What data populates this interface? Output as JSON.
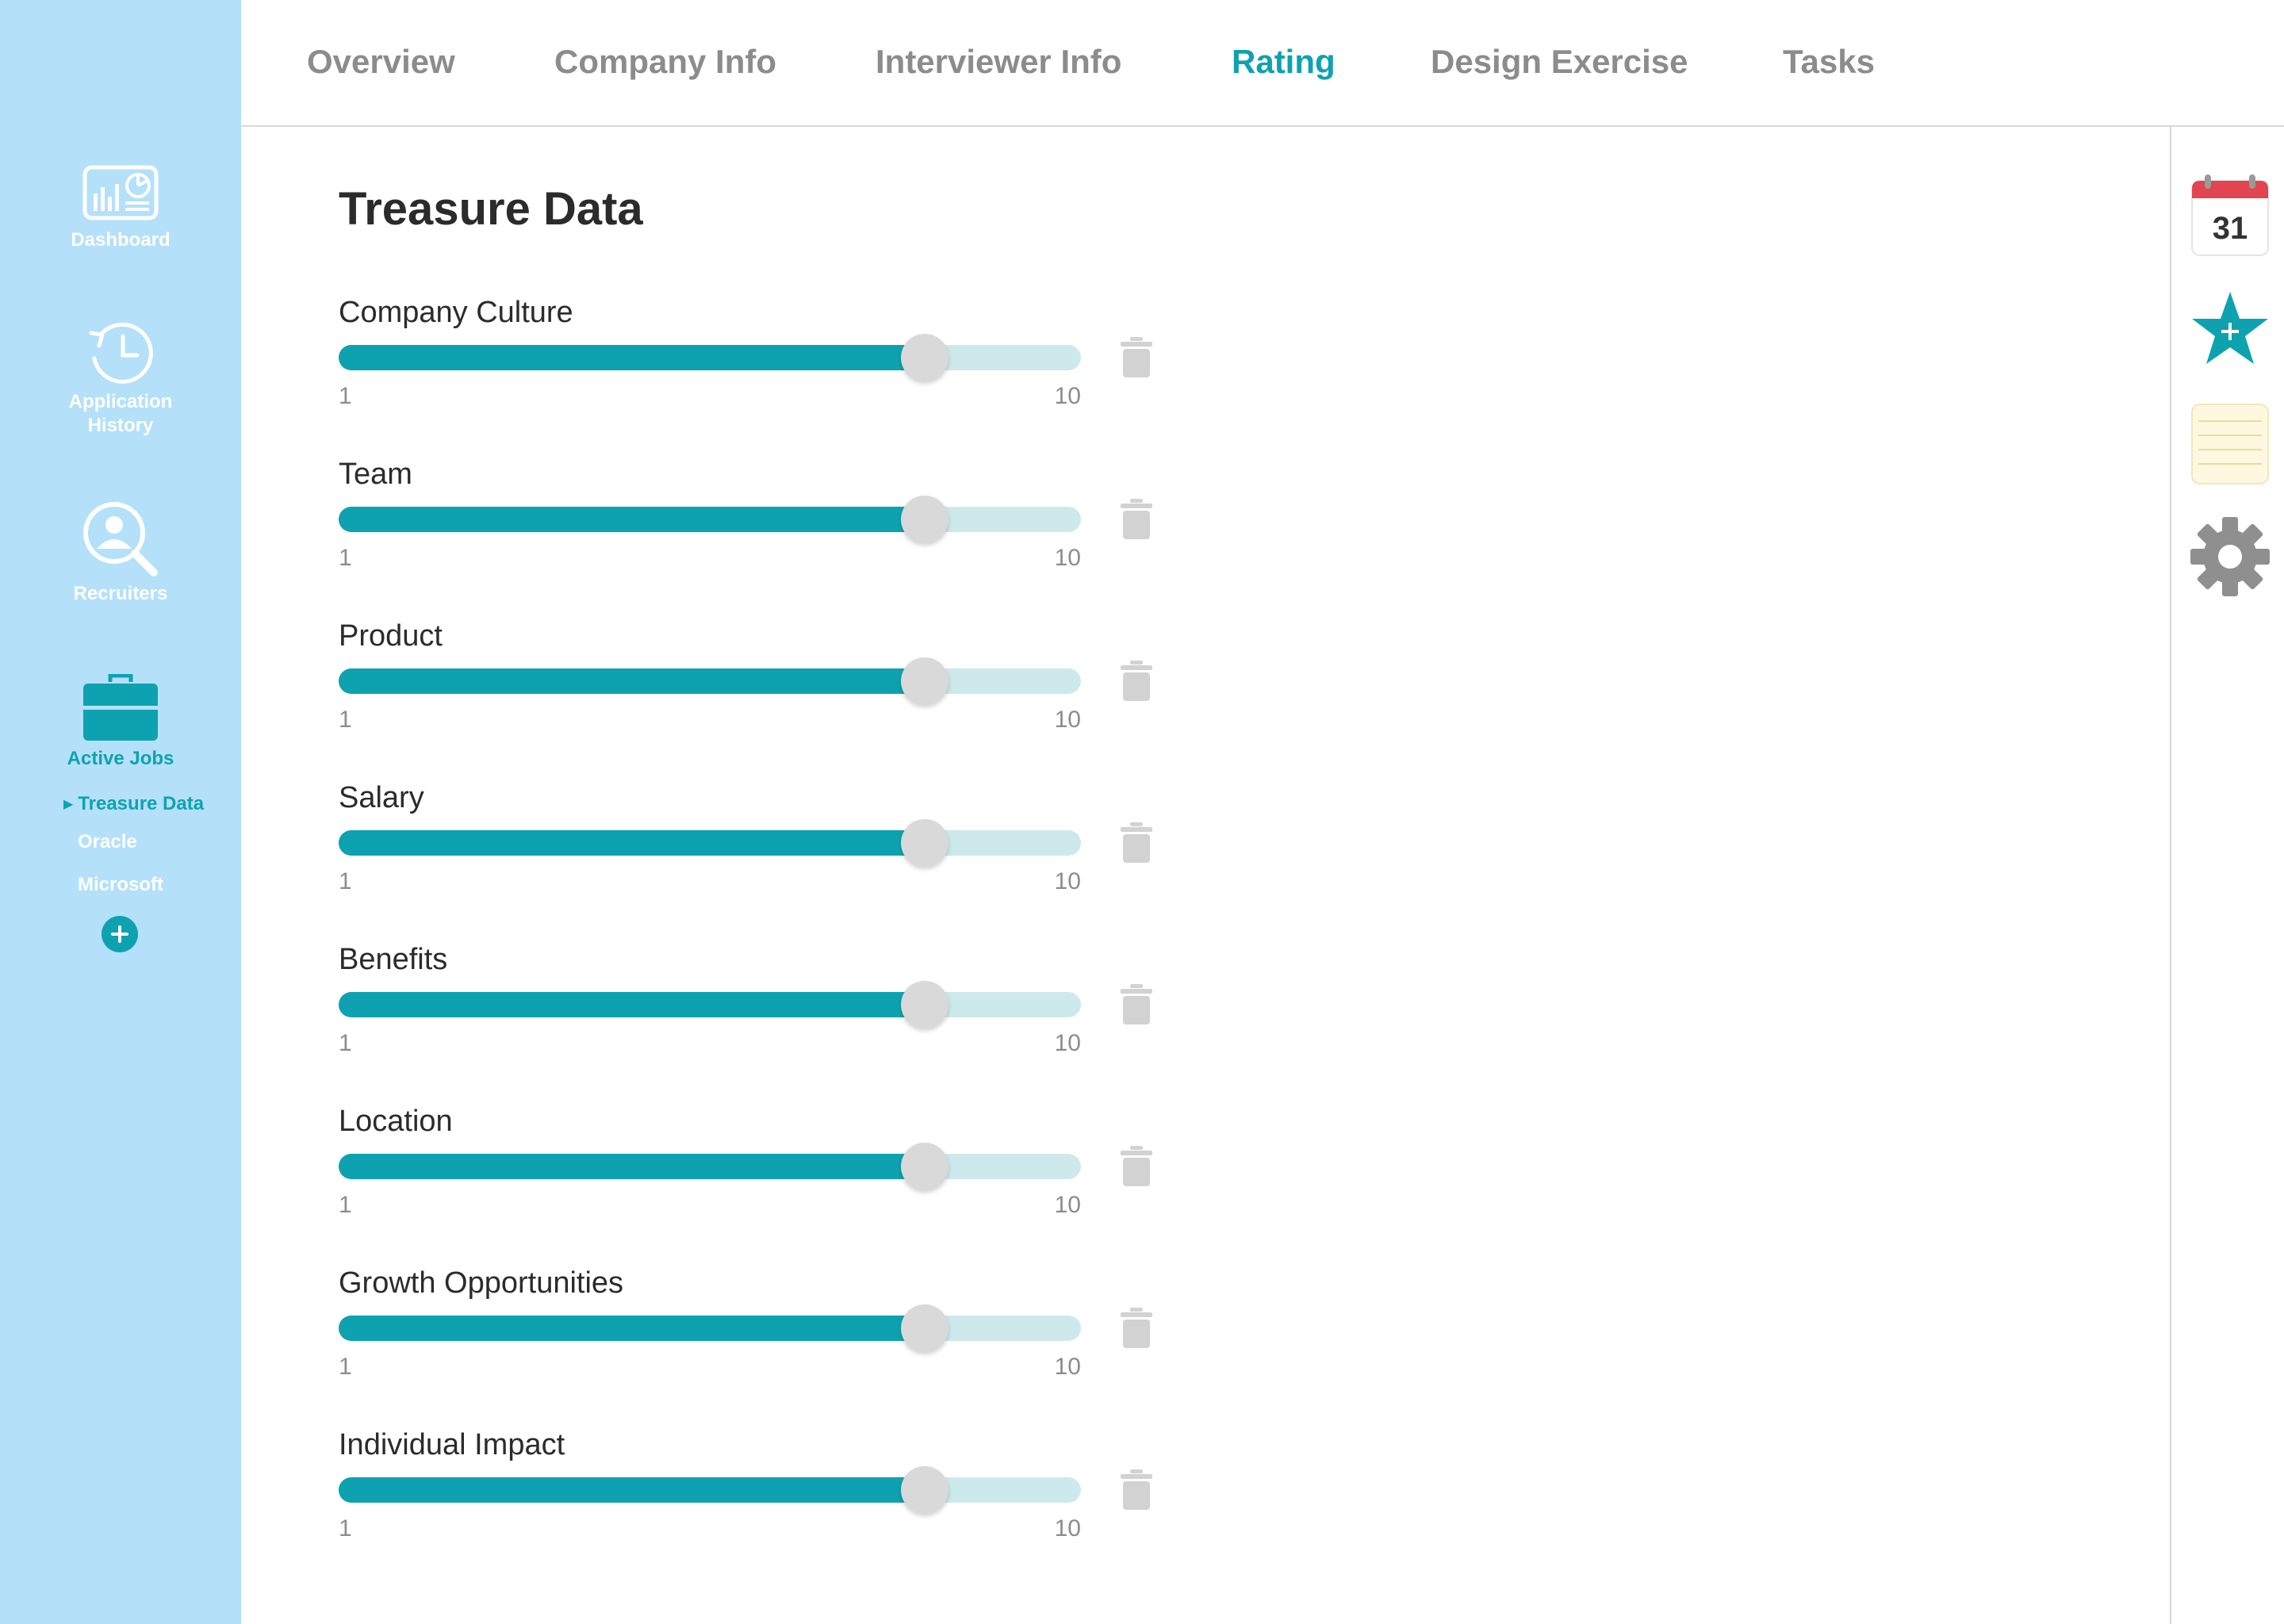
{
  "sidebar": {
    "items": [
      {
        "label": "Dashboard",
        "icon": "dashboard-icon",
        "active": false
      },
      {
        "label": "Application History",
        "icon": "history-clock-icon",
        "active": false
      },
      {
        "label": "Recruiters",
        "icon": "recruiter-search-icon",
        "active": false
      },
      {
        "label": "Active Jobs",
        "icon": "briefcase-icon",
        "active": true
      }
    ],
    "jobs": [
      {
        "label": "Treasure Data",
        "current": true
      },
      {
        "label": "Oracle",
        "current": false
      },
      {
        "label": "Microsoft",
        "current": false
      }
    ],
    "add_job_icon": "plus-circle-icon"
  },
  "tabs": [
    {
      "label": "Overview",
      "active": false
    },
    {
      "label": "Company Info",
      "active": false
    },
    {
      "label": "Interviewer Info",
      "active": false
    },
    {
      "label": "Rating",
      "active": true
    },
    {
      "label": "Design Exercise",
      "active": false
    },
    {
      "label": "Tasks",
      "active": false
    }
  ],
  "page_title": "Treasure Data",
  "ratings": [
    {
      "label": "Company Culture",
      "min": "1",
      "max": "10",
      "value_fraction": 0.79
    },
    {
      "label": "Team",
      "min": "1",
      "max": "10",
      "value_fraction": 0.79
    },
    {
      "label": "Product",
      "min": "1",
      "max": "10",
      "value_fraction": 0.79
    },
    {
      "label": "Salary",
      "min": "1",
      "max": "10",
      "value_fraction": 0.79
    },
    {
      "label": "Benefits",
      "min": "1",
      "max": "10",
      "value_fraction": 0.79
    },
    {
      "label": "Location",
      "min": "1",
      "max": "10",
      "value_fraction": 0.79
    },
    {
      "label": "Growth Opportunities",
      "min": "1",
      "max": "10",
      "value_fraction": 0.79
    },
    {
      "label": "Individual Impact",
      "min": "1",
      "max": "10",
      "value_fraction": 0.79
    }
  ],
  "right_tools": {
    "calendar_day": "31",
    "calendar_icon": "calendar-icon",
    "favorite_icon": "star-plus-icon",
    "notes_icon": "notepad-icon",
    "settings_icon": "gear-icon"
  },
  "colors": {
    "accent": "#0ea2b0",
    "sidebar_bg": "#b4e0f9",
    "track_bg": "#cde9ec",
    "tab_inactive": "#8c8c8c"
  }
}
